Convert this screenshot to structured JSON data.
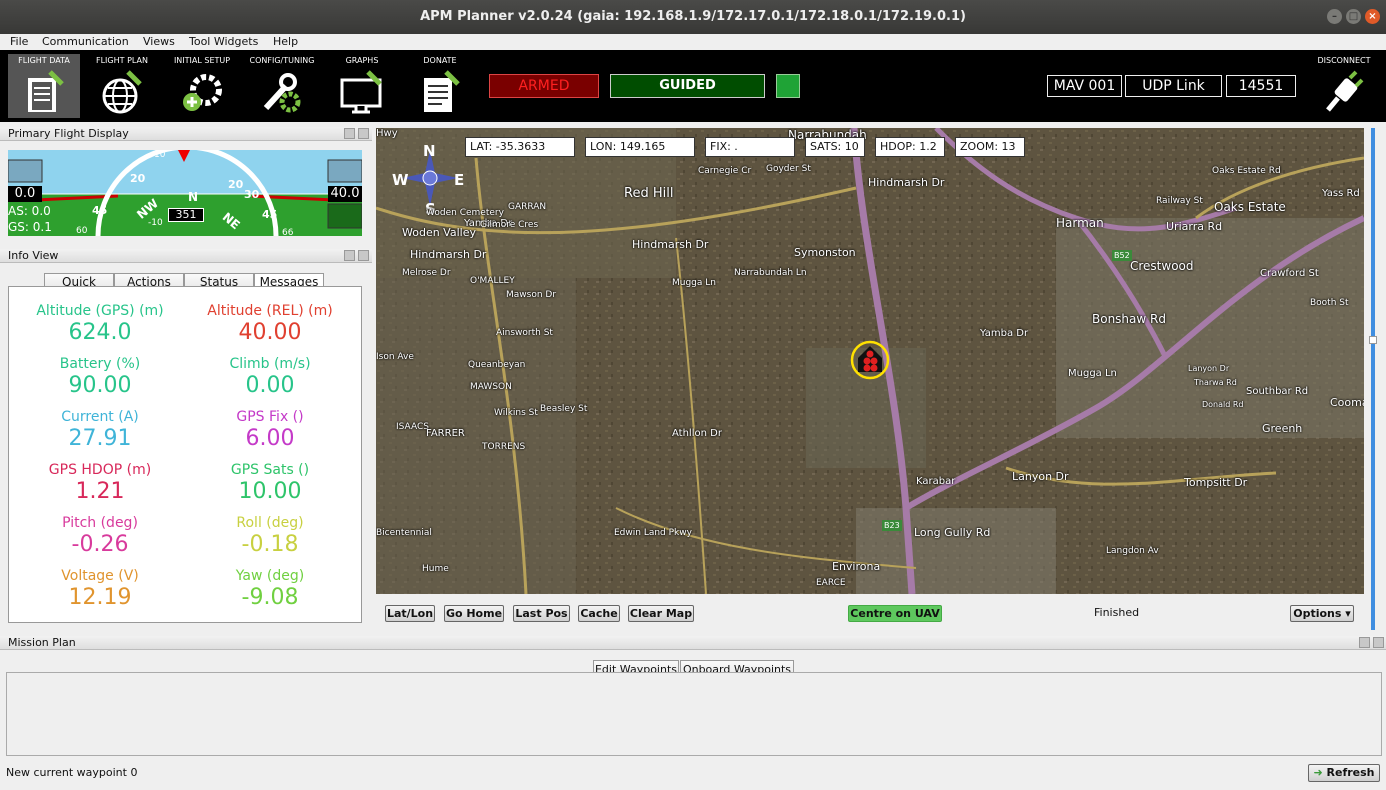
{
  "window": {
    "title": "APM Planner v2.0.24 (gaia: 192.168.1.9/172.17.0.1/172.18.0.1/172.19.0.1)"
  },
  "menu": [
    "File",
    "Communication",
    "Views",
    "Tool Widgets",
    "Help"
  ],
  "toolbar": {
    "buttons": [
      {
        "label": "FLIGHT DATA",
        "icon": "clipboard-icon"
      },
      {
        "label": "FLIGHT PLAN",
        "icon": "globe-icon"
      },
      {
        "label": "INITIAL SETUP",
        "icon": "gear-plus-icon"
      },
      {
        "label": "CONFIG/TUNING",
        "icon": "wrench-gear-icon"
      },
      {
        "label": "GRAPHS",
        "icon": "monitor-icon"
      },
      {
        "label": "DONATE",
        "icon": "document-icon"
      }
    ],
    "armed": "ARMED",
    "mode": "GUIDED",
    "mav": "MAV 001",
    "link": "UDP Link",
    "port": "14551",
    "disconnect": "DISCONNECT",
    "colors": {
      "armed_bg": "#7a0000",
      "armed_text": "#ff2020",
      "mode_bg": "#004d00",
      "indicator": "#1fa336"
    }
  },
  "pfd": {
    "title": "Primary Flight Display",
    "alt_left": "0.0",
    "as": "AS: 0.0",
    "gs": "GS: 0.1",
    "alt_right": "40.0",
    "heading": "351",
    "compass": {
      "nw": "NW",
      "n": "N",
      "ne": "NE"
    },
    "pitch_marks": {
      "a": "10",
      "b": "20",
      "c": "20",
      "d": "30",
      "e": "45",
      "f": "45",
      "g": "-10",
      "h": "60",
      "i": "66"
    }
  },
  "info": {
    "title": "Info View",
    "tabs": [
      "Quick",
      "Actions",
      "Status",
      "Messages"
    ],
    "cells": [
      {
        "label": "Altitude (GPS) (m)",
        "value": "624.0",
        "color": "#27c48a"
      },
      {
        "label": "Altitude (REL) (m)",
        "value": "40.00",
        "color": "#e04030"
      },
      {
        "label": "Battery (%)",
        "value": "90.00",
        "color": "#27c48a"
      },
      {
        "label": "Climb (m/s)",
        "value": "0.00",
        "color": "#27c48a"
      },
      {
        "label": "Current (A)",
        "value": "27.91",
        "color": "#3fb4d8"
      },
      {
        "label": "GPS Fix ()",
        "value": "6.00",
        "color": "#c43ac8"
      },
      {
        "label": "GPS HDOP (m)",
        "value": "1.21",
        "color": "#d8285a"
      },
      {
        "label": "GPS Sats ()",
        "value": "10.00",
        "color": "#2ec46a"
      },
      {
        "label": "Pitch (deg)",
        "value": "-0.26",
        "color": "#d83a9c"
      },
      {
        "label": "Roll (deg)",
        "value": "-0.18",
        "color": "#c8d040"
      },
      {
        "label": "Voltage (V)",
        "value": "12.19",
        "color": "#e0942e"
      },
      {
        "label": "Yaw (deg)",
        "value": "-9.08",
        "color": "#70d040"
      }
    ]
  },
  "map": {
    "lat": "LAT: -35.3633",
    "lon": "LON: 149.165",
    "fix": "FIX: .",
    "sats": "SATS: 10",
    "hdop": "HDOP: 1.2",
    "zoom": "ZOOM: 13",
    "compass": {
      "n": "N",
      "w": "W",
      "e": "E",
      "s": "S"
    },
    "places": [
      "Narrabundah",
      "Red Hill",
      "Goyder St",
      "Carnegie Cr",
      "Hindmarsh Dr",
      "Harman",
      "Railway St",
      "Oaks Estate",
      "Uriarra Rd",
      "Yass Rd",
      "Oaks Estate Rd",
      "Woden Cemetery",
      "Woden Valley",
      "Yamba Dr",
      "GARRAN",
      "Gilmore Cres",
      "Hindmarsh Dr",
      "Symonston",
      "Mugga Ln",
      "Narrabundah Ln",
      "Crestwood",
      "Crawford St",
      "Booth St",
      "Hindmarsh Dr",
      "Melrose Dr",
      "Mawson Dr",
      "O'MALLEY",
      "Ainsworth St",
      "Yamba Dr",
      "Bonshaw Rd",
      "Queanbeyan",
      "MAWSON",
      "Wilkins St",
      "Beasley St",
      "ISAACS",
      "TORRENS",
      "FARRER",
      "Athllon Dr",
      "Mugga Ln",
      "Lanyon Dr",
      "Tharwa Rd",
      "Donald Rd",
      "Southbar Rd",
      "Cooma St",
      "Greenh",
      "Karabar",
      "Lanyon Dr",
      "Tompsitt Dr",
      "Edwin Land Pkwy",
      "Long Gully Rd",
      "Environa",
      "Hume",
      "Langdon Av",
      "Bicentennial",
      "Ison Ave",
      "EARCE",
      "Hwy"
    ],
    "badges": [
      "B52",
      "B23"
    ]
  },
  "mapbar": {
    "buttons": [
      "Lat/Lon",
      "Go Home",
      "Last Pos",
      "Cache",
      "Clear Map",
      "Centre on UAV",
      "Options"
    ],
    "status": "Finished"
  },
  "mission": {
    "title": "Mission Plan",
    "tabs": [
      "Edit Waypoints",
      "Onboard Waypoints"
    ],
    "status": "New current waypoint 0",
    "refresh": "Refresh"
  }
}
